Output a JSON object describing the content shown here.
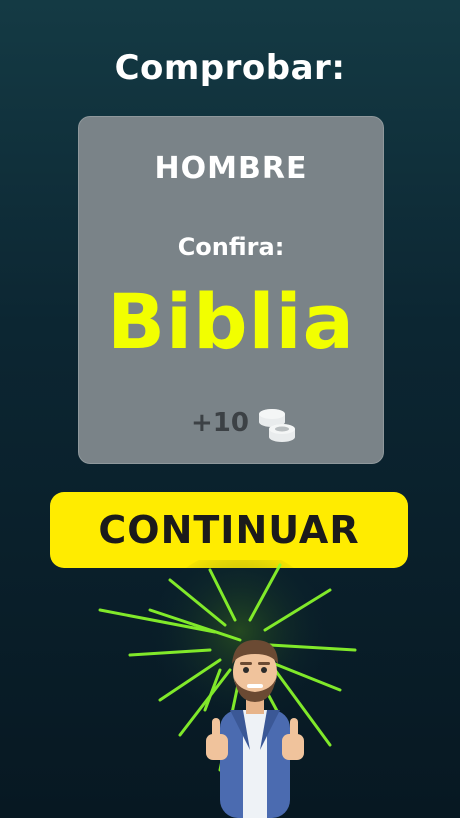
{
  "title": "Comprobar:",
  "card": {
    "word": "HOMBRE",
    "check_label": "Confira:",
    "answer": "Biblia",
    "reward": "+10"
  },
  "icons": {
    "reward": "coins-icon",
    "illustration": "thumbs-up-man-illustration",
    "effect": "light-burst"
  },
  "continue_button": {
    "label": "CONTINUAR"
  },
  "colors": {
    "accent_yellow": "#ffec00",
    "answer_yellow": "#f2ff00",
    "card_gray": "#7a8388",
    "burst_green": "#8eff2b"
  }
}
